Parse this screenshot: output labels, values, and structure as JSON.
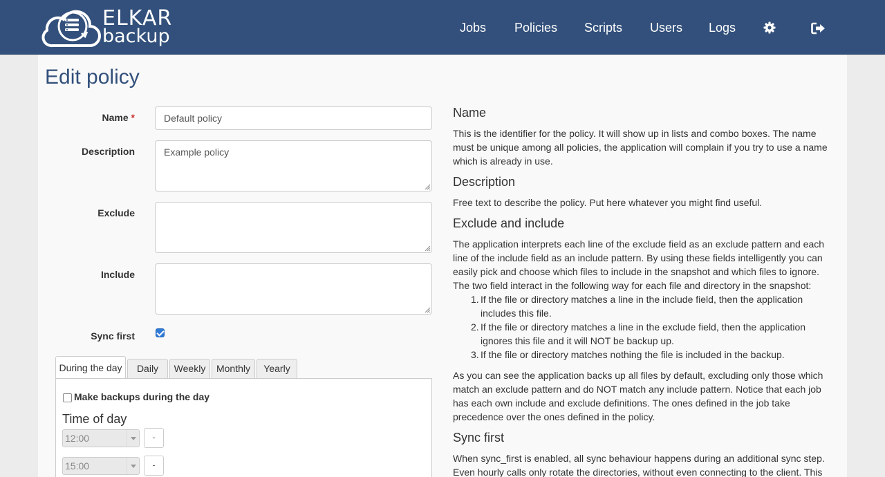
{
  "brand": {
    "line1": "ELKAR",
    "line2": "backup"
  },
  "nav": {
    "jobs": "Jobs",
    "policies": "Policies",
    "scripts": "Scripts",
    "users": "Users",
    "logs": "Logs",
    "settings_icon": "gear-icon",
    "logout_icon": "sign-out-icon"
  },
  "page": {
    "title": "Edit policy"
  },
  "form": {
    "name": {
      "label": "Name",
      "required_mark": "*",
      "value": "Default policy"
    },
    "description": {
      "label": "Description",
      "value": "Example policy"
    },
    "exclude": {
      "label": "Exclude",
      "value": ""
    },
    "include": {
      "label": "Include",
      "value": ""
    },
    "sync_first": {
      "label": "Sync first",
      "checked": true
    }
  },
  "schedule": {
    "tabs": [
      "During the day",
      "Daily",
      "Weekly",
      "Monthly",
      "Yearly"
    ],
    "active_tab": "During the day",
    "make_backups_label": "Make backups during the day",
    "make_backups_checked": false,
    "time_heading": "Time of day",
    "times": [
      {
        "value": "12:00",
        "remove_label": "-"
      },
      {
        "value": "15:00",
        "remove_label": "-"
      }
    ]
  },
  "help": {
    "name_title": "Name",
    "name_text": "This is the identifier for the policy. It will show up in lists and combo boxes. The name must be unique among all policies, the application will complain if you try to use a name which is already in use.",
    "description_title": "Description",
    "description_text": "Free text to describe the policy. Put here whatever you might find useful.",
    "exclude_title": "Exclude and include",
    "exclude_text": "The application interprets each line of the exclude field as an exclude pattern and each line of the include field as an include pattern. By using these fields intelligently you can easily pick and choose which files to include in the snapshot and which files to ignore. The two field interact in the following way for each file and directory in the snapshot:",
    "rules": [
      {
        "num": "1.",
        "text": "If the file or directory matches a line in the include field, then the application includes this file."
      },
      {
        "num": "2.",
        "text": "If the file or directory matches a line in the exclude field, then the application ignores this file and it will NOT be backup up."
      },
      {
        "num": "3.",
        "text": "If the file or directory matches nothing the file is included in the backup."
      }
    ],
    "exclude_text2": "As you can see the application backs up all files by default, excluding only those which match an exclude pattern and do NOT match any include pattern. Notice that each job has each own include and exclude definitions. The ones defined in the job take precedence over the ones defined in the policy.",
    "sync_title": "Sync first",
    "sync_text": "When sync_first is enabled, all sync behaviour happens during an additional sync step. Even hourly calls only rotate the directories, without even connecting to the client. This"
  },
  "colors": {
    "navbar": "#32507b",
    "title": "#32507b",
    "checkbox_checked": "#2e7ad6",
    "required": "#c9302c"
  }
}
